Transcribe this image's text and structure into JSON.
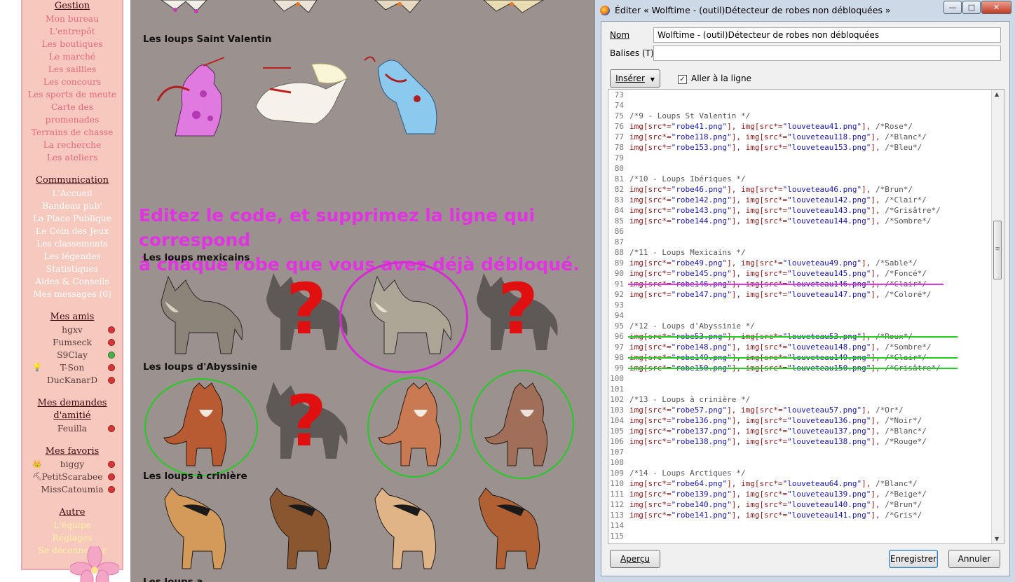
{
  "sidebar": {
    "gestion": {
      "header": "Gestion",
      "items": [
        "Mon bureau",
        "L'entrepôt",
        "Les boutiques",
        "Le marché",
        "Les saillies",
        "Les concours",
        "Les sports de meute",
        "Carte des",
        "promenades",
        "Terrains de chasse",
        "La recherche",
        "Les ateliers"
      ]
    },
    "communication": {
      "header": "Communication",
      "items": [
        "L'Accueil",
        "Bandeau pub'",
        "La Place Publique",
        "Le Coin des Jeux",
        "Les classements",
        "Les légendes",
        "Statistiques",
        "Aides & Conseils",
        "Mes messages (0)"
      ]
    },
    "amis": {
      "header": "Mes amis",
      "items": [
        {
          "name": "hgxv",
          "status": "offline"
        },
        {
          "name": "Fumseck",
          "status": "offline"
        },
        {
          "name": "S9Clay",
          "status": "online"
        },
        {
          "name": "T-Son",
          "status": "offline"
        },
        {
          "name": "DucKanarD",
          "status": "offline"
        }
      ]
    },
    "demandes": {
      "header_line1": "Mes demandes",
      "header_line2": "d'amitié",
      "items": [
        {
          "name": "Feuilla",
          "status": "offline"
        }
      ]
    },
    "favoris": {
      "header": "Mes favoris",
      "items": [
        {
          "name": "biggy",
          "status": "offline"
        },
        {
          "name": "PetitScarabee",
          "status": "offline"
        },
        {
          "name": "MissCatoumia",
          "status": "offline"
        }
      ]
    },
    "autre": {
      "header": "Autre",
      "items": [
        "L'équipe",
        "Réglages",
        "Se déconnecter"
      ]
    }
  },
  "game": {
    "sections": {
      "saint_valentin": "Les loups Saint Valentin",
      "mexicains": "Les loups mexicains",
      "abyssinie": "Les loups d'Abyssinie",
      "criniere": "Les loups à crinière",
      "next": "Les loups a..."
    },
    "annotation_line1": "Editez le code, et supprimez la ligne qui correspond",
    "annotation_line2": "à chaque robe que vous avez déjà débloqué.",
    "question_mark": "?"
  },
  "dialog": {
    "title": "Éditer « Wolftime - (outil)Détecteur de robes non débloquées »",
    "window_buttons": {
      "minimize": "—",
      "maximize": "□",
      "close": "✕"
    },
    "nom_label": "Nom",
    "nom_value": "Wolftime - (outil)Détecteur de robes non débloquées",
    "balises_label": "Balises (T)",
    "balises_value": "",
    "inserer_label": "Insérer",
    "wrap_label": "Aller à la ligne",
    "wrap_checked": true,
    "apercu_label": "Aperçu",
    "enregistrer_label": "Enregistrer",
    "annuler_label": "Annuler"
  },
  "code": {
    "lines": [
      {
        "n": "73",
        "t": ""
      },
      {
        "n": "74",
        "t": ""
      },
      {
        "n": "75",
        "t": "/*9 - Loups St Valentin */"
      },
      {
        "n": "76",
        "t": "img[src*=\"robe41.png\"], img[src*=\"louveteau41.png\"], /*Rose*/"
      },
      {
        "n": "77",
        "t": "img[src*=\"robe118.png\"], img[src*=\"louveteau118.png\"], /*Blanc*/"
      },
      {
        "n": "78",
        "t": "img[src*=\"robe153.png\"], img[src*=\"louveteau153.png\"], /*Bleu*/"
      },
      {
        "n": "79",
        "t": ""
      },
      {
        "n": "80",
        "t": ""
      },
      {
        "n": "81",
        "t": "/*10 - Loups Ibériques */"
      },
      {
        "n": "82",
        "t": "img[src*=\"robe46.png\"], img[src*=\"louveteau46.png\"], /*Brun*/"
      },
      {
        "n": "83",
        "t": "img[src*=\"robe142.png\"], img[src*=\"louveteau142.png\"], /*Clair*/"
      },
      {
        "n": "84",
        "t": "img[src*=\"robe143.png\"], img[src*=\"louveteau143.png\"], /*Grisâtre*/"
      },
      {
        "n": "85",
        "t": "img[src*=\"robe144.png\"], img[src*=\"louveteau144.png\"], /*Sombre*/"
      },
      {
        "n": "86",
        "t": ""
      },
      {
        "n": "87",
        "t": ""
      },
      {
        "n": "88",
        "t": "/*11 - Loups Mexicains */"
      },
      {
        "n": "89",
        "t": "img[src*=\"robe49.png\"], img[src*=\"louveteau49.png\"], /*Sable*/"
      },
      {
        "n": "90",
        "t": "img[src*=\"robe145.png\"], img[src*=\"louveteau145.png\"], /*Foncé*/"
      },
      {
        "n": "91",
        "t": "img[src*=\"robe146.png\"], img[src*=\"louveteau146.png\"], /*Clair*/",
        "strike": "magenta"
      },
      {
        "n": "92",
        "t": "img[src*=\"robe147.png\"], img[src*=\"louveteau147.png\"], /*Coloré*/"
      },
      {
        "n": "93",
        "t": ""
      },
      {
        "n": "94",
        "t": ""
      },
      {
        "n": "95",
        "t": "/*12 - Loups d'Abyssinie */"
      },
      {
        "n": "96",
        "t": "img[src*=\"robe53.png\"], img[src*=\"louveteau53.png\"], /*Roux*/",
        "strike": "green"
      },
      {
        "n": "97",
        "t": "img[src*=\"robe148.png\"], img[src*=\"louveteau148.png\"], /*Sombre*/"
      },
      {
        "n": "98",
        "t": "img[src*=\"robe149.png\"], img[src*=\"louveteau149.png\"], /*Clair*/",
        "strike": "green"
      },
      {
        "n": "99",
        "t": "img[src*=\"robe150.png\"], img[src*=\"louveteau150.png\"], /*Grisâtre*/",
        "strike": "green"
      },
      {
        "n": "100",
        "t": ""
      },
      {
        "n": "101",
        "t": ""
      },
      {
        "n": "102",
        "t": "/*13 - Loups à crinière */"
      },
      {
        "n": "103",
        "t": "img[src*=\"robe57.png\"], img[src*=\"louveteau57.png\"], /*Or*/"
      },
      {
        "n": "104",
        "t": "img[src*=\"robe136.png\"], img[src*=\"louveteau136.png\"], /*Noir*/"
      },
      {
        "n": "105",
        "t": "img[src*=\"robe137.png\"], img[src*=\"louveteau137.png\"], /*Blanc*/"
      },
      {
        "n": "106",
        "t": "img[src*=\"robe138.png\"], img[src*=\"louveteau138.png\"], /*Rouge*/"
      },
      {
        "n": "107",
        "t": ""
      },
      {
        "n": "108",
        "t": ""
      },
      {
        "n": "109",
        "t": "/*14 - Loups Arctiques */"
      },
      {
        "n": "110",
        "t": "img[src*=\"robe64.png\"], img[src*=\"louveteau64.png\"], /*Blanc*/"
      },
      {
        "n": "111",
        "t": "img[src*=\"robe139.png\"], img[src*=\"louveteau139.png\"], /*Beige*/"
      },
      {
        "n": "112",
        "t": "img[src*=\"robe140.png\"], img[src*=\"louveteau140.png\"], /*Brun*/"
      },
      {
        "n": "113",
        "t": "img[src*=\"robe141.png\"], img[src*=\"louveteau141.png\"], /*Gris*/"
      },
      {
        "n": "114",
        "t": ""
      },
      {
        "n": "115",
        "t": ""
      }
    ]
  },
  "colors": {
    "sidebar_bg": "#f6c8be",
    "sidebar_link": "#e86a76",
    "game_bg": "#9b918e",
    "annotation": "#e233e2",
    "strike_magenta": "#e233e2",
    "strike_green": "#22cc22",
    "question_mark": "#e01010"
  }
}
